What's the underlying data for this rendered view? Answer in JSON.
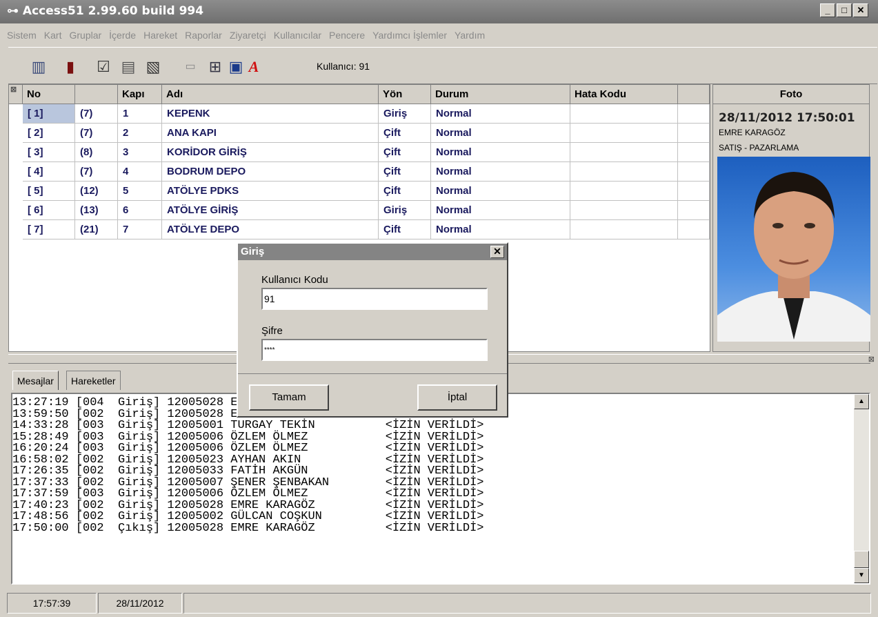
{
  "window": {
    "title": "Access51 2.99.60 build 994",
    "min": "_",
    "max": "□",
    "close": "✕"
  },
  "menu": [
    "Sistem",
    "Kart",
    "Gruplar",
    "İçerde",
    "Hareket",
    "Raporlar",
    "Ziyaretçi",
    "Kullanıcılar",
    "Pencere",
    "Yardımcı İşlemler",
    "Yardım"
  ],
  "toolbar": {
    "user_label": "Kullanıcı: 91"
  },
  "grid": {
    "columns": {
      "no": "No",
      "blank": "",
      "kapi": "Kapı",
      "adi": "Adı",
      "yon": "Yön",
      "durum": "Durum",
      "hata": "Hata Kodu"
    },
    "rows": [
      {
        "no": "[ 1]",
        "grp": "(7)",
        "kapi": "1",
        "adi": "KEPENK",
        "yon": "Giriş",
        "durum": "Normal"
      },
      {
        "no": "[ 2]",
        "grp": "(7)",
        "kapi": "2",
        "adi": "ANA KAPI",
        "yon": "Çift",
        "durum": "Normal"
      },
      {
        "no": "[ 3]",
        "grp": "(8)",
        "kapi": "3",
        "adi": "KORİDOR GİRİŞ",
        "yon": "Çift",
        "durum": "Normal"
      },
      {
        "no": "[ 4]",
        "grp": "(7)",
        "kapi": "4",
        "adi": "BODRUM DEPO",
        "yon": "Çift",
        "durum": "Normal"
      },
      {
        "no": "[ 5]",
        "grp": "(12)",
        "kapi": "5",
        "adi": "ATÖLYE PDKS",
        "yon": "Çift",
        "durum": "Normal"
      },
      {
        "no": "[ 6]",
        "grp": "(13)",
        "kapi": "6",
        "adi": "ATÖLYE GİRİŞ",
        "yon": "Giriş",
        "durum": "Normal"
      },
      {
        "no": "[ 7]",
        "grp": "(21)",
        "kapi": "7",
        "adi": "ATÖLYE DEPO",
        "yon": "Çift",
        "durum": "Normal"
      }
    ]
  },
  "foto": {
    "header": "Foto",
    "datetime": "28/11/2012 17:50:01",
    "name": "EMRE KARAGÖZ",
    "department": "SATIŞ - PAZARLAMA"
  },
  "tabs": [
    "Mesajlar",
    "Hareketler"
  ],
  "log": [
    "13:27:19 [004  Giriş] 12005028 EMRE KARAGÖZ          <İZİN VERİLDİ>",
    "13:59:50 [002  Giriş] 12005028 EMRE KARAGÖZ          <İZİN VERİLDİ>",
    "14:33:28 [003  Giriş] 12005001 TURGAY TEKİN          <İZİN VERİLDİ>",
    "15:28:49 [003  Giriş] 12005006 ÖZLEM ÖLMEZ           <İZİN VERİLDİ>",
    "16:20:24 [003  Giriş] 12005006 ÖZLEM ÖLMEZ           <İZİN VERİLDİ>",
    "16:58:02 [002  Giriş] 12005023 AYHAN AKIN            <İZİN VERİLDİ>",
    "17:26:35 [002  Giriş] 12005033 FATİH AKGÜN           <İZİN VERİLDİ>",
    "17:37:33 [002  Giriş] 12005007 ŞENER ŞENBAKAN        <İZİN VERİLDİ>",
    "17:37:59 [003  Giriş] 12005006 ÖZLEM ÖLMEZ           <İZİN VERİLDİ>",
    "17:40:23 [002  Giriş] 12005028 EMRE KARAGÖZ          <İZİN VERİLDİ>",
    "17:48:56 [002  Giriş] 12005002 GÜLCAN COŞKUN         <İZİN VERİLDİ>",
    "17:50:00 [002  Çıkış] 12005028 EMRE KARAGÖZ          <İZİN VERİLDİ>"
  ],
  "status": {
    "time": "17:57:39",
    "date": "28/11/2012"
  },
  "dialog": {
    "title": "Giriş",
    "user_code_label": "Kullanıcı Kodu",
    "user_code_value": "91",
    "password_label": "Şifre",
    "password_value": "****",
    "ok_label": "Tamam",
    "cancel_label": "İptal"
  },
  "colors": {
    "grid_text": "#1a1a5e",
    "title_bar": "#7a7a7a",
    "selected_cell": "#b9c6dd"
  }
}
